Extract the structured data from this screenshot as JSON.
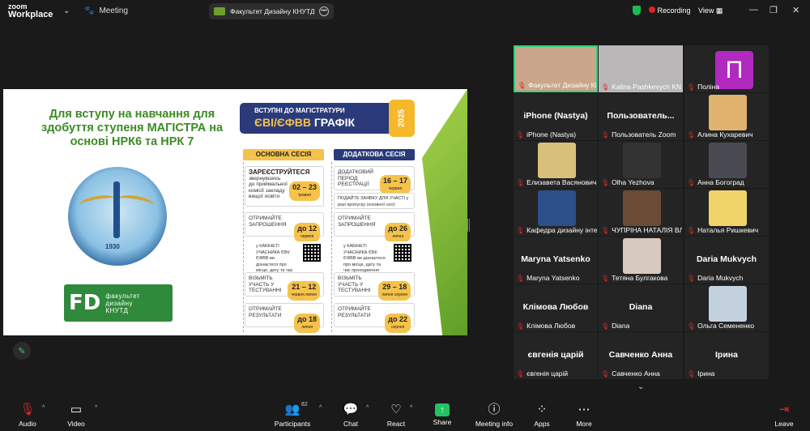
{
  "app": {
    "logo_top": "zoom",
    "logo_bottom": "Workplace",
    "meeting_label": "Meeting"
  },
  "share": {
    "label": "Факультет Дизайну КНУТД's scr"
  },
  "status": {
    "recording": "Recording",
    "view": "View"
  },
  "slide": {
    "title": "Для вступу на навчання для здобуття ступеня МАГІСТРА на основі НРК6 та НРК 7",
    "emblem_year": "1930",
    "fd_mark": "FD",
    "fd_text_1": "факультет",
    "fd_text_2": "дизайну",
    "fd_text_3": "КНУТД",
    "banner_line1": "ВСТУПНІ ДО МАГІСТРАТУРИ",
    "banner_line2a": "ЄВІ/ЄФВВ",
    "banner_line2b": "ГРАФІК",
    "year": "2025",
    "col_main": "ОСНОВНА СЕСІЯ",
    "col_extra": "ДОДАТКОВА СЕСІЯ",
    "main": [
      {
        "title": "ЗАРЕЄСТРУЙТЕСЯ",
        "desc": "звернувшись до приймальної комісії закладу вищої освіти",
        "date": "02 – 23",
        "sub": "травня"
      },
      {
        "title": "",
        "desc": "ОТРИМАЙТЕ ЗАПРОШЕННЯ",
        "date": "до 12",
        "sub": "червня"
      },
      {
        "title": "",
        "desc": "у КАБІНЕТІ УЧАСНИКА ЄВІ/ЄФВВ ви дізнаєтеся про місце, дату та час проходження тесту",
        "date": "",
        "sub": ""
      },
      {
        "title": "",
        "desc": "ВІЗЬМІТЬ УЧАСТЬ У ТЕСТУВАННІ",
        "date": "21 – 12",
        "sub": "червня  липня"
      },
      {
        "title": "",
        "desc": "ОТРИМАЙТЕ РЕЗУЛЬТАТИ",
        "date": "до 18",
        "sub": "липня"
      }
    ],
    "extra": [
      {
        "desc": "ДОДАТКОВИЙ ПЕРІОД РЕЄСТРАЦІЇ",
        "date": "16 – 17",
        "sub": "червня"
      },
      {
        "desc": "ПОДАЙТЕ ЗАЯВКУ ДЛЯ УЧАСТІ у разі пропуску основної сесії",
        "date": "",
        "sub": ""
      },
      {
        "desc": "ОТРИМАЙТЕ ЗАПРОШЕННЯ",
        "date": "до 26",
        "sub": "липня"
      },
      {
        "desc": "у КАБІНЕТІ УЧАСНИКА ЄВІ/ЄФВВ ви дізнаєтеся про місце, дату та час проходження тесту",
        "date": "",
        "sub": ""
      },
      {
        "desc": "ВІЗЬМІТЬ УЧАСТЬ У ТЕСТУВАННІ",
        "date": "29 – 18",
        "sub": "липня  серпня"
      },
      {
        "desc": "ОТРИМАЙТЕ РЕЗУЛЬТАТИ",
        "date": "до 22",
        "sub": "серпня"
      }
    ]
  },
  "gallery": {
    "tiles": [
      {
        "name": "Факультет Дизайну КНУТД",
        "big": "",
        "type": "video",
        "color": "#c9a68c"
      },
      {
        "name": "Kalina Pashkevych KN...",
        "big": "",
        "type": "video",
        "color": "#b9b7b8"
      },
      {
        "name": "Поліна",
        "big": "",
        "type": "avatar",
        "initial": "П"
      },
      {
        "name": "iPhone (Nastya)",
        "big": "iPhone (Nastya)",
        "type": "name"
      },
      {
        "name": "Пользователь Zoom",
        "big": "Пользователь...",
        "type": "name"
      },
      {
        "name": "Алина Кухаревич",
        "big": "",
        "type": "photo",
        "color": "#e0b36f"
      },
      {
        "name": "Елизавета Васянович",
        "big": "",
        "type": "photo",
        "color": "#d9c07a"
      },
      {
        "name": "Olha Yezhova",
        "big": "",
        "type": "photo",
        "color": "#333333"
      },
      {
        "name": "Анна Богоград",
        "big": "",
        "type": "photo",
        "color": "#4a4a52"
      },
      {
        "name": "Кафедра дизайну інте...",
        "big": "",
        "type": "photo",
        "color": "#2d4f8a"
      },
      {
        "name": "ЧУПРІНА НАТАЛІЯ ВЛ...",
        "big": "",
        "type": "photo",
        "color": "#6b4b35"
      },
      {
        "name": "Наталья Ришкевич",
        "big": "",
        "type": "photo",
        "color": "#f0d46a"
      },
      {
        "name": "Maryna Yatsenko",
        "big": "Maryna Yatsenko",
        "type": "name"
      },
      {
        "name": "Тетяна Булгакова",
        "big": "",
        "type": "photo",
        "color": "#d7c8c0"
      },
      {
        "name": "Daria Mukvych",
        "big": "Daria Mukvych",
        "type": "name"
      },
      {
        "name": "Клімова Любов",
        "big": "Клімова Любов",
        "type": "name"
      },
      {
        "name": "Diana",
        "big": "Diana",
        "type": "name"
      },
      {
        "name": "Ольга Семененко",
        "big": "",
        "type": "photo",
        "color": "#c4d2e0"
      },
      {
        "name": "євгенія царій",
        "big": "євгенія царій",
        "type": "name"
      },
      {
        "name": "Савченко Анна",
        "big": "Савченко Анна",
        "type": "name"
      },
      {
        "name": "Ірина",
        "big": "Ірина",
        "type": "name"
      }
    ]
  },
  "toolbar": {
    "audio": "Audio",
    "video": "Video",
    "participants": "Participants",
    "participant_count": "82",
    "chat": "Chat",
    "react": "React",
    "share": "Share",
    "meeting_info": "Meeting info",
    "apps": "Apps",
    "more": "More",
    "leave": "Leave"
  }
}
